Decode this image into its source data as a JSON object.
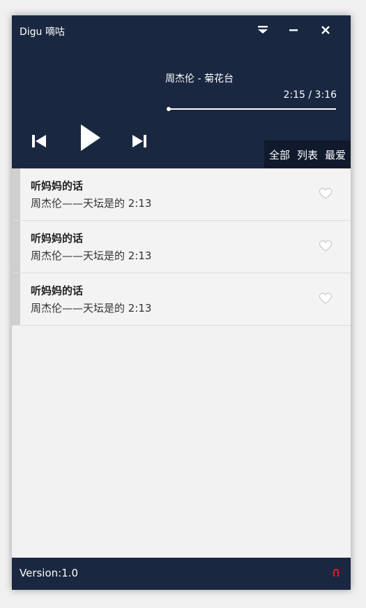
{
  "app": {
    "title": "Digu 嘀咕"
  },
  "player": {
    "now_playing": "周杰伦 - 菊花台",
    "time": "2:15 / 3:16",
    "progress": 0.0
  },
  "tabs": [
    {
      "label": "全部"
    },
    {
      "label": "列表"
    },
    {
      "label": "最爱"
    }
  ],
  "songs": [
    {
      "title": "听妈妈的话",
      "subtitle": "周杰伦——天坛是的  2:13"
    },
    {
      "title": "听妈妈的话",
      "subtitle": "周杰伦——天坛是的  2:13"
    },
    {
      "title": "听妈妈的话",
      "subtitle": "周杰伦——天坛是的  2:13"
    }
  ],
  "footer": {
    "version": "Version:1.0"
  },
  "colors": {
    "header_bg": "#1a2740",
    "tabs_bg": "#101a2c",
    "list_bg": "#f3f3f3",
    "accent_red": "#e02020"
  },
  "icons": {
    "menu": "dropdown-menu-icon",
    "minimize": "minimize-icon",
    "close": "close-icon",
    "prev": "skip-previous-icon",
    "play": "play-icon",
    "next": "skip-next-icon",
    "favorite": "heart-icon",
    "footer": "magnet-icon"
  }
}
